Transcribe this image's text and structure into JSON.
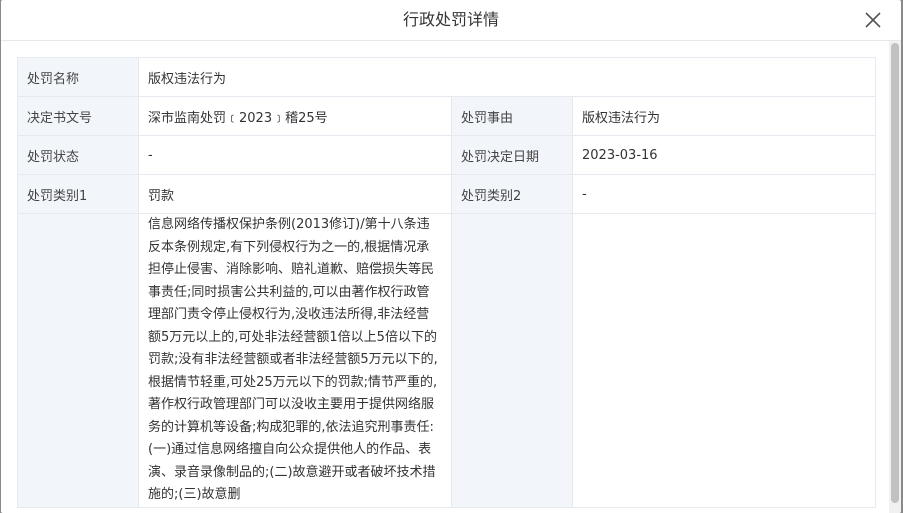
{
  "modal": {
    "title": "行政处罚详情",
    "close_icon": "close-icon"
  },
  "details": {
    "row1": {
      "label": "处罚名称",
      "value": "版权违法行为"
    },
    "row2": {
      "label_left": "决定书文号",
      "value_left": "深市监南处罚﹝2023﹞稽25号",
      "label_right": "处罚事由",
      "value_right": "版权违法行为"
    },
    "row3": {
      "label_left": "处罚状态",
      "value_left": "-",
      "label_right": "处罚决定日期",
      "value_right": "2023-03-16"
    },
    "row4": {
      "label_left": "处罚类别1",
      "value_left": "罚款",
      "label_right": "处罚类别2",
      "value_right": "-"
    },
    "row5": {
      "label_left": "",
      "value_left": "信息网络传播权保护条例(2013修订)/第十八条违反本条例规定,有下列侵权行为之一的,根据情况承担停止侵害、消除影响、赔礼道歉、赔偿损失等民事责任;同时损害公共利益的,可以由著作权行政管理部门责令停止侵权行为,没收违法所得,非法经营额5万元以上的,可处非法经营额1倍以上5倍以下的罚款;没有非法经营额或者非法经营额5万元以下的,根据情节轻重,可处25万元以下的罚款;情节严重的,著作权行政管理部门可以没收主要用于提供网络服务的计算机等设备;构成犯罪的,依法追究刑事责任:(一)通过信息网络擅自向公众提供他人的作品、表演、录音录像制品的;(二)故意避开或者破坏技术措施的;(三)故意删",
      "label_right": "",
      "value_right": ""
    }
  }
}
